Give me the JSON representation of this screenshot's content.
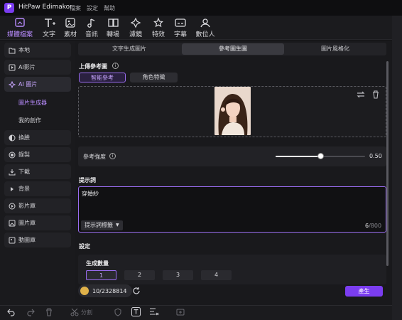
{
  "window": {
    "app_name": "HitPaw Edimakor",
    "menu": [
      "檔案",
      "設定",
      "幫助"
    ]
  },
  "toolbar": {
    "items": [
      {
        "label": "媒體檔案",
        "icon": "media-icon",
        "active": true
      },
      {
        "label": "文字",
        "icon": "text-icon"
      },
      {
        "label": "素材",
        "icon": "assets-icon"
      },
      {
        "label": "音訊",
        "icon": "music-icon"
      },
      {
        "label": "轉場",
        "icon": "transition-icon"
      },
      {
        "label": "濾鏡",
        "icon": "filter-icon"
      },
      {
        "label": "特效",
        "icon": "effects-icon"
      },
      {
        "label": "字幕",
        "icon": "subtitle-icon"
      },
      {
        "label": "數位人",
        "icon": "avatar-icon"
      }
    ]
  },
  "sidebar": {
    "items": [
      {
        "label": "本地",
        "icon": "folder-icon"
      },
      {
        "label": "AI影片",
        "icon": "ai-video-icon"
      },
      {
        "label": "AI 圖片",
        "icon": "ai-image-icon",
        "active": true
      },
      {
        "label": "換臉",
        "icon": "face-swap-icon"
      },
      {
        "label": "錄製",
        "icon": "record-icon"
      },
      {
        "label": "下載",
        "icon": "download-icon"
      },
      {
        "label": "背景",
        "icon": "background-icon"
      },
      {
        "label": "影片庫",
        "icon": "video-library-icon"
      },
      {
        "label": "圖片庫",
        "icon": "image-library-icon"
      },
      {
        "label": "動圖庫",
        "icon": "gif-library-icon"
      }
    ],
    "sub_items": [
      {
        "label": "圖片生成器",
        "active": true
      },
      {
        "label": "我的創作"
      }
    ]
  },
  "main": {
    "tabs": [
      {
        "label": "文字生成圖片"
      },
      {
        "label": "參考圖生圖",
        "active": true
      },
      {
        "label": "圖片風格化"
      }
    ],
    "upload_label": "上傳參考圖",
    "ref_modes": [
      {
        "label": "智能參考",
        "active": true
      },
      {
        "label": "角色特徵"
      }
    ],
    "strength": {
      "label": "參考強度",
      "value": "0.50",
      "fraction": 0.5
    },
    "prompt": {
      "label": "提示詞",
      "text": "穿婚紗",
      "tag_button": "提示詞標籤",
      "count": "6",
      "max": "/800"
    },
    "settings_label": "設定",
    "quantity": {
      "label": "生成數量",
      "options": [
        "1",
        "2",
        "3",
        "4"
      ],
      "selected": "1"
    },
    "credits": "10/2328814",
    "generate_button": "產生"
  },
  "colors": {
    "accent": "#9a6cf0",
    "generate": "#7b3df0"
  }
}
